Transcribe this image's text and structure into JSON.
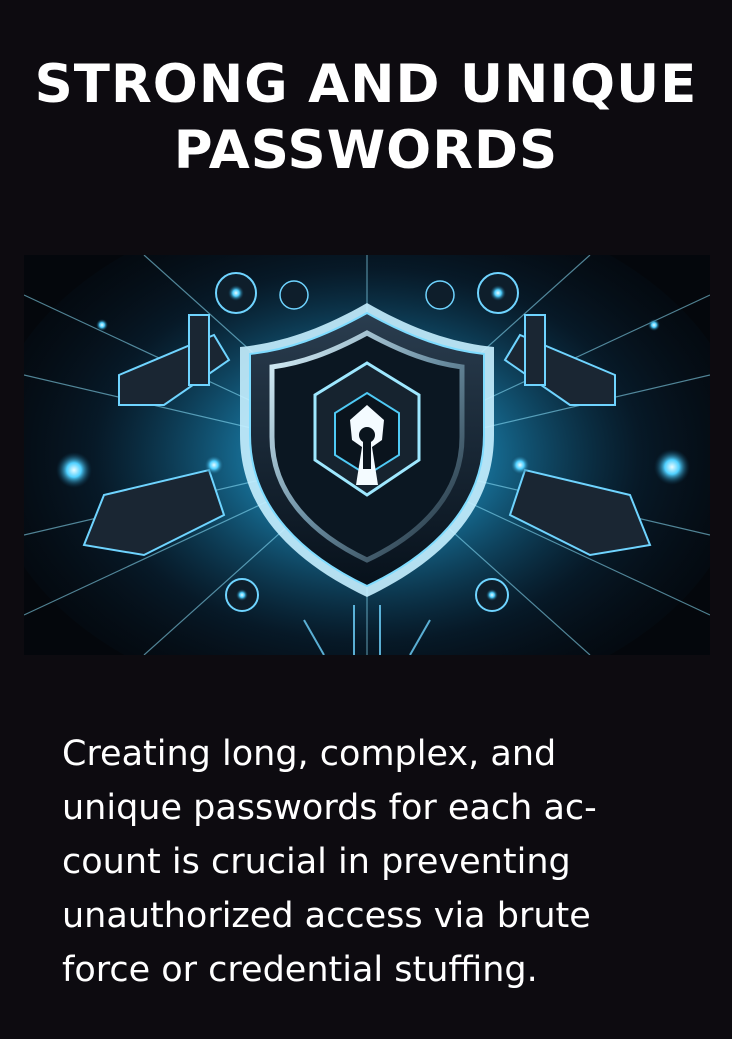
{
  "title": {
    "line1": "STRONG AND UNIQUE",
    "line2": "PASSWORDS"
  },
  "hero": {
    "icon": "shield-keyhole-icon"
  },
  "body": {
    "lines": [
      "Creating long, complex, and",
      "unique passwords for each ac-",
      "count is crucial in preventing",
      "unauthorized access via brute",
      "force or credential stuffing."
    ]
  },
  "colors": {
    "background": "#0d0b10",
    "text": "#ffffff",
    "accent": "#3fc3f0"
  }
}
